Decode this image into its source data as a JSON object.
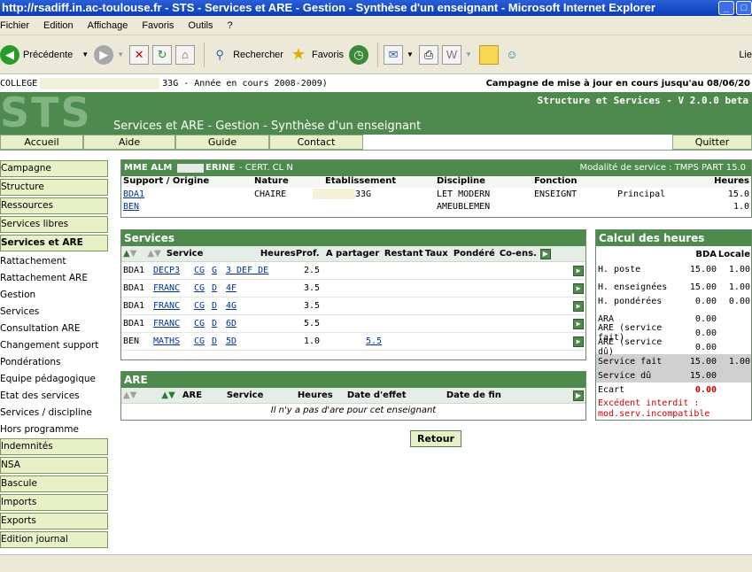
{
  "window": {
    "title": "http://rsadiff.in.ac-toulouse.fr - STS - Services et ARE - Gestion - Synthèse d'un enseignant - Microsoft Internet Explorer"
  },
  "menu": [
    "Fichier",
    "Edition",
    "Affichage",
    "Favoris",
    "Outils",
    "?"
  ],
  "toolbar": {
    "back_label": "Précédente",
    "search_label": "Rechercher",
    "favorites_label": "Favoris",
    "links_label": "Lie"
  },
  "infobar": {
    "college_prefix": "COLLEGE",
    "college_suffix": "33G - Année en cours 2008-2009)",
    "campagne": "Campagne de mise à jour en cours jusqu'au 08/06/20"
  },
  "banner": {
    "logo": "STS",
    "version": "Structure et Services - V 2.0.0 beta",
    "heading": "Services et ARE - Gestion - Synthèse d'un enseignant"
  },
  "topnav": [
    "Accueil",
    "Aide",
    "Guide",
    "Contact"
  ],
  "quit_label": "Quitter",
  "sidebar": {
    "top": [
      "Campagne",
      "Structure",
      "Ressources",
      "Services libres",
      "Services et ARE"
    ],
    "sub": [
      "Rattachement",
      "Rattachement ARE",
      "Gestion",
      "Services",
      "Consultation ARE",
      "Changement support",
      "Pondérations",
      "Equipe pédagogique",
      "Etat des services",
      "Services / discipline",
      "Hors programme"
    ],
    "bottom": [
      "Indemnités",
      "NSA",
      "Bascule",
      "Imports",
      "Exports",
      "Edition journal"
    ]
  },
  "teacher": {
    "name_prefix": "MME ALM",
    "name_suffix": "ERINE",
    "grade": "- CERT. CL N",
    "modalite": "Modalité  de service : TMPS PART  15.0",
    "columns": [
      "Support / Origine",
      "Nature",
      "Etablissement",
      "Discipline",
      "Fonction",
      "Heures"
    ],
    "rows": [
      {
        "support": "BDA1",
        "nature": "CHAIRE",
        "etab": "33G",
        "discipline": "LET MODERN",
        "fonction": "ENSEIGNT",
        "fonction2": "Principal",
        "heures": "15.0"
      },
      {
        "support": "BEN",
        "nature": "",
        "etab": "",
        "discipline": "AMEUBLEMEN",
        "fonction": "",
        "fonction2": "",
        "heures": "1.0"
      }
    ]
  },
  "services": {
    "title": "Services",
    "columns": [
      "Service",
      "Heures",
      "Prof.",
      "A partager",
      "Restant",
      "Taux",
      "Pondéré",
      "Co-ens."
    ],
    "rows": [
      {
        "support": "BDA1",
        "s1": "DECP3",
        "s2": "CG",
        "s3": "G",
        "s4": "3 DEF DE",
        "heures": "2.5",
        "partager": ""
      },
      {
        "support": "BDA1",
        "s1": "FRANC",
        "s2": "CG",
        "s3": "D",
        "s4": "4F",
        "heures": "3.5",
        "partager": ""
      },
      {
        "support": "BDA1",
        "s1": "FRANC",
        "s2": "CG",
        "s3": "D",
        "s4": "4G",
        "heures": "3.5",
        "partager": ""
      },
      {
        "support": "BDA1",
        "s1": "FRANC",
        "s2": "CG",
        "s3": "D",
        "s4": "6D",
        "heures": "5.5",
        "partager": ""
      },
      {
        "support": "BEN",
        "s1": "MATHS",
        "s2": "CG",
        "s3": "D",
        "s4": "5D",
        "heures": "1.0",
        "partager": "5.5"
      }
    ]
  },
  "are": {
    "title": "ARE",
    "columns": [
      "ARE",
      "Service",
      "Heures",
      "Date d'effet",
      "Date de fin"
    ],
    "empty": "Il n'y a pas d'are pour cet enseignant"
  },
  "calc": {
    "title": "Calcul des heures",
    "col_bda": "BDA",
    "col_locale": "Locale",
    "rows": [
      {
        "label": "H. poste",
        "bda": "15.00",
        "locale": "1.00"
      },
      {
        "label": "H. enseignées",
        "bda": "15.00",
        "locale": "1.00"
      },
      {
        "label": "H. pondérées",
        "bda": "0.00",
        "locale": "0.00"
      },
      {
        "label": "ARA",
        "bda": "0.00",
        "locale": ""
      },
      {
        "label": "ARE (service fait)",
        "bda": "0.00",
        "locale": ""
      },
      {
        "label": "ARE (service dû)",
        "bda": "0.00",
        "locale": ""
      },
      {
        "label": "Service fait",
        "bda": "15.00",
        "locale": "1.00"
      },
      {
        "label": "Service dû",
        "bda": "15.00",
        "locale": ""
      },
      {
        "label": "Ecart",
        "bda": "0.00",
        "locale": ""
      }
    ],
    "warning": "Excédent interdit : mod.serv.incompatible"
  },
  "retour_label": "Retour",
  "colors": {
    "header_green": "#4e8a4e",
    "nav_bg": "#e8f0c8",
    "warning_red": "#cc0000"
  }
}
